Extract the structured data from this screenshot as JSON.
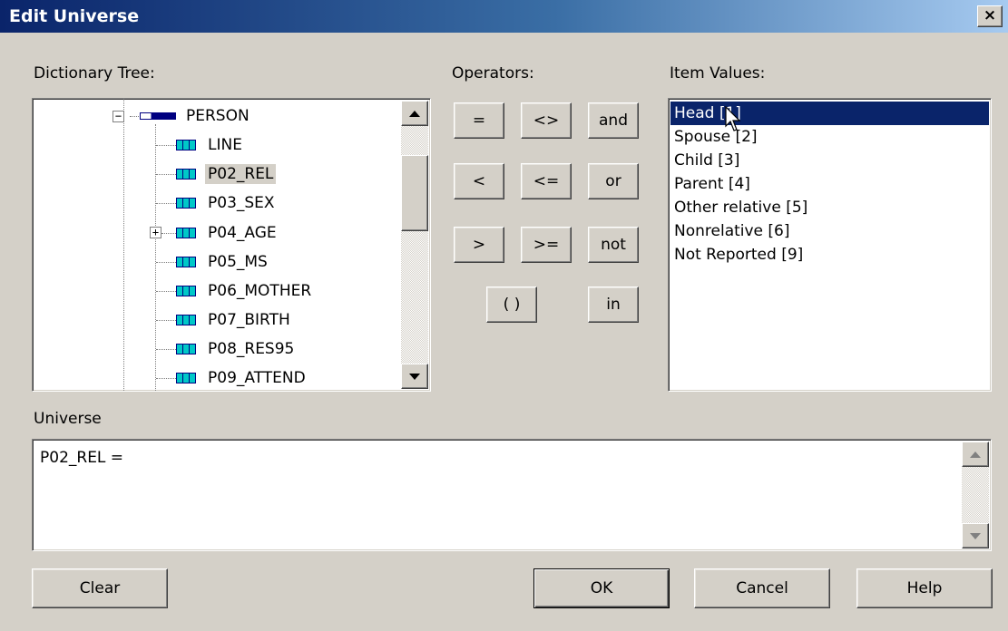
{
  "window": {
    "title": "Edit Universe",
    "close_label": "×"
  },
  "labels": {
    "dictionary_tree": "Dictionary Tree:",
    "operators": "Operators:",
    "item_values": "Item Values:",
    "universe": "Universe"
  },
  "tree": {
    "record": "PERSON",
    "items": [
      "LINE",
      "P02_REL",
      "P03_SEX",
      "P04_AGE",
      "P05_MS",
      "P06_MOTHER",
      "P07_BIRTH",
      "P08_RES95",
      "P09_ATTEND"
    ],
    "selected": "P02_REL",
    "expand_minus": "−",
    "expand_plus": "+"
  },
  "operators": {
    "eq": "=",
    "ne": "<>",
    "and": "and",
    "lt": "<",
    "le": "<=",
    "or": "or",
    "gt": ">",
    "ge": ">=",
    "not": "not",
    "paren": "( )",
    "in": "in"
  },
  "item_values": {
    "items": [
      "Head [1]",
      "Spouse [2]",
      "Child [3]",
      "Parent [4]",
      "Other relative [5]",
      "Nonrelative [6]",
      "Not Reported [9]"
    ],
    "selected_index": 0
  },
  "universe": {
    "expression": "P02_REL ="
  },
  "buttons": {
    "clear": "Clear",
    "ok": "OK",
    "cancel": "Cancel",
    "help": "Help"
  },
  "colors": {
    "face": "#d4d0c8",
    "selection": "#0a246a",
    "title_start": "#0a246a"
  }
}
